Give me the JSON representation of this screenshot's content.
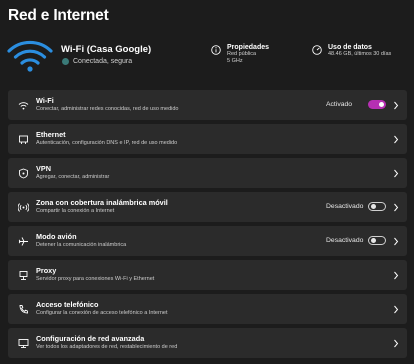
{
  "page": {
    "title": "Red e Internet"
  },
  "network": {
    "name": "Wi-Fi (Casa Google)",
    "status": "Conectada, segura",
    "properties": {
      "title": "Propiedades",
      "line1": "Red pública",
      "line2": "5 GHz"
    },
    "data_usage": {
      "title": "Uso de datos",
      "line1": "48.46 GB, últimos 30 días"
    }
  },
  "settings": [
    {
      "icon": "wifi-icon",
      "title": "Wi-Fi",
      "subtitle": "Conectar, administrar redes conocidas, red de uso medido",
      "state": "Activado",
      "toggle": "on"
    },
    {
      "icon": "ethernet-icon",
      "title": "Ethernet",
      "subtitle": "Autenticación, configuración DNS e IP, red de uso medido"
    },
    {
      "icon": "vpn-shield-icon",
      "title": "VPN",
      "subtitle": "Agregar, conectar, administrar"
    },
    {
      "icon": "hotspot-icon",
      "title": "Zona con cobertura inalámbrica móvil",
      "subtitle": "Compartir la conexión a Internet",
      "state": "Desactivado",
      "toggle": "off"
    },
    {
      "icon": "airplane-icon",
      "title": "Modo avión",
      "subtitle": "Detener la comunicación inalámbrica",
      "state": "Desactivado",
      "toggle": "off"
    },
    {
      "icon": "proxy-icon",
      "title": "Proxy",
      "subtitle": "Servidor proxy para conexiones Wi-Fi y Ethernet"
    },
    {
      "icon": "dial-up-phone-icon",
      "title": "Acceso telefónico",
      "subtitle": "Configurar la conexión de acceso telefónico a Internet"
    },
    {
      "icon": "advanced-network-icon",
      "title": "Configuración de red avanzada",
      "subtitle": "Ver todos los adaptadores de red, restablecimiento de red"
    }
  ],
  "colors": {
    "accent": "#b62fb3",
    "background": "#1c1c1c",
    "card": "#2b2b2b",
    "wifi": "#2b8ee0"
  }
}
